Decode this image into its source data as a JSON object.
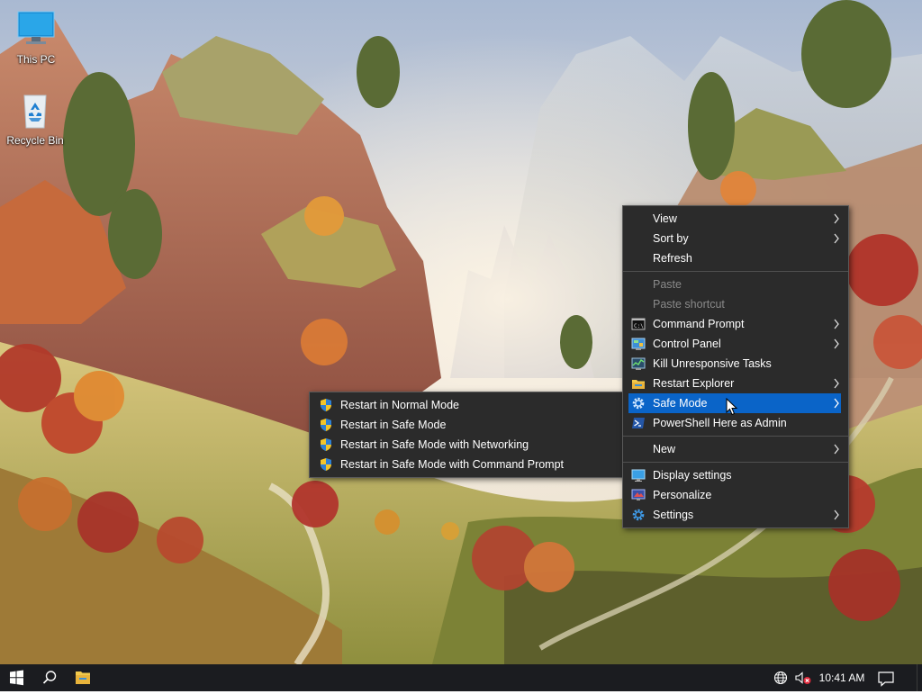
{
  "desktop": {
    "icons": [
      {
        "label": "This PC",
        "icon": "monitor-icon"
      },
      {
        "label": "Recycle Bin",
        "icon": "recycle-bin-icon"
      }
    ]
  },
  "context_menu": {
    "items": [
      {
        "label": "View",
        "has_submenu": true,
        "enabled": true
      },
      {
        "label": "Sort by",
        "has_submenu": true,
        "enabled": true
      },
      {
        "label": "Refresh",
        "has_submenu": false,
        "enabled": true
      },
      {
        "label": "Paste",
        "has_submenu": false,
        "enabled": false
      },
      {
        "label": "Paste shortcut",
        "has_submenu": false,
        "enabled": false
      },
      {
        "label": "Command Prompt",
        "icon": "command-prompt-icon",
        "has_submenu": true,
        "enabled": true
      },
      {
        "label": "Control Panel",
        "icon": "control-panel-icon",
        "has_submenu": true,
        "enabled": true
      },
      {
        "label": "Kill Unresponsive Tasks",
        "icon": "task-manager-icon",
        "has_submenu": false,
        "enabled": true
      },
      {
        "label": "Restart Explorer",
        "icon": "folder-icon",
        "has_submenu": true,
        "enabled": true
      },
      {
        "label": "Safe Mode",
        "icon": "gear-icon",
        "has_submenu": true,
        "enabled": true,
        "highlighted": true
      },
      {
        "label": "PowerShell Here as Admin",
        "icon": "powershell-icon",
        "has_submenu": false,
        "enabled": true
      },
      {
        "label": "New",
        "has_submenu": true,
        "enabled": true
      },
      {
        "label": "Display settings",
        "icon": "display-icon",
        "has_submenu": false,
        "enabled": true
      },
      {
        "label": "Personalize",
        "icon": "personalize-icon",
        "has_submenu": false,
        "enabled": true
      },
      {
        "label": "Settings",
        "icon": "gear-icon",
        "has_submenu": true,
        "enabled": true
      }
    ],
    "highlight_color": "#0a64c8"
  },
  "safe_mode_submenu": {
    "items": [
      {
        "label": "Restart in Normal Mode",
        "icon": "uac-shield-icon"
      },
      {
        "label": "Restart in Safe Mode",
        "icon": "uac-shield-icon"
      },
      {
        "label": "Restart in Safe Mode with Networking",
        "icon": "uac-shield-icon"
      },
      {
        "label": "Restart in Safe Mode with Command Prompt",
        "icon": "uac-shield-icon"
      }
    ]
  },
  "taskbar": {
    "start_icon": "windows-logo-icon",
    "search_icon": "search-icon",
    "pinned": [
      {
        "name": "File Explorer",
        "icon": "folder-icon"
      }
    ],
    "tray": {
      "network_icon": "globe-icon",
      "volume_icon": "volume-muted-icon",
      "clock": "10:41 AM",
      "notification_icon": "notification-icon"
    }
  }
}
